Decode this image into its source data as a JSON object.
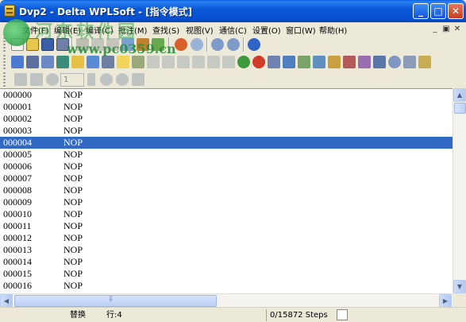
{
  "window": {
    "title": "Dvp2 - Delta WPLSoft - [指令模式]",
    "minimize": "_",
    "maximize": "□",
    "close": "✕"
  },
  "watermark": {
    "url_text": "www.pc0359.cn",
    "cn_text": "河东软件园"
  },
  "menubar": {
    "items": [
      {
        "label": "文件(F)"
      },
      {
        "label": "编辑(E)"
      },
      {
        "label": "编译(C)"
      },
      {
        "label": "批注(M)"
      },
      {
        "label": "查找(S)"
      },
      {
        "label": "视图(V)"
      },
      {
        "label": "通信(C)"
      },
      {
        "label": "设置(O)"
      },
      {
        "label": "窗口(W)"
      },
      {
        "label": "帮助(H)"
      }
    ],
    "mdi_controls": [
      "_",
      "▣",
      "✕"
    ]
  },
  "toolbar3": {
    "step_value": "1"
  },
  "code": {
    "rows": [
      {
        "step": "000000",
        "instr": "NOP"
      },
      {
        "step": "000001",
        "instr": "NOP"
      },
      {
        "step": "000002",
        "instr": "NOP"
      },
      {
        "step": "000003",
        "instr": "NOP"
      },
      {
        "step": "000004",
        "instr": "NOP"
      },
      {
        "step": "000005",
        "instr": "NOP"
      },
      {
        "step": "000006",
        "instr": "NOP"
      },
      {
        "step": "000007",
        "instr": "NOP"
      },
      {
        "step": "000008",
        "instr": "NOP"
      },
      {
        "step": "000009",
        "instr": "NOP"
      },
      {
        "step": "000010",
        "instr": "NOP"
      },
      {
        "step": "000011",
        "instr": "NOP"
      },
      {
        "step": "000012",
        "instr": "NOP"
      },
      {
        "step": "000013",
        "instr": "NOP"
      },
      {
        "step": "000014",
        "instr": "NOP"
      },
      {
        "step": "000015",
        "instr": "NOP"
      },
      {
        "step": "000016",
        "instr": "NOP"
      }
    ],
    "selected_index": 4
  },
  "statusbar": {
    "mode": "替换",
    "line": "行:4",
    "steps": "0/15872 Steps"
  }
}
